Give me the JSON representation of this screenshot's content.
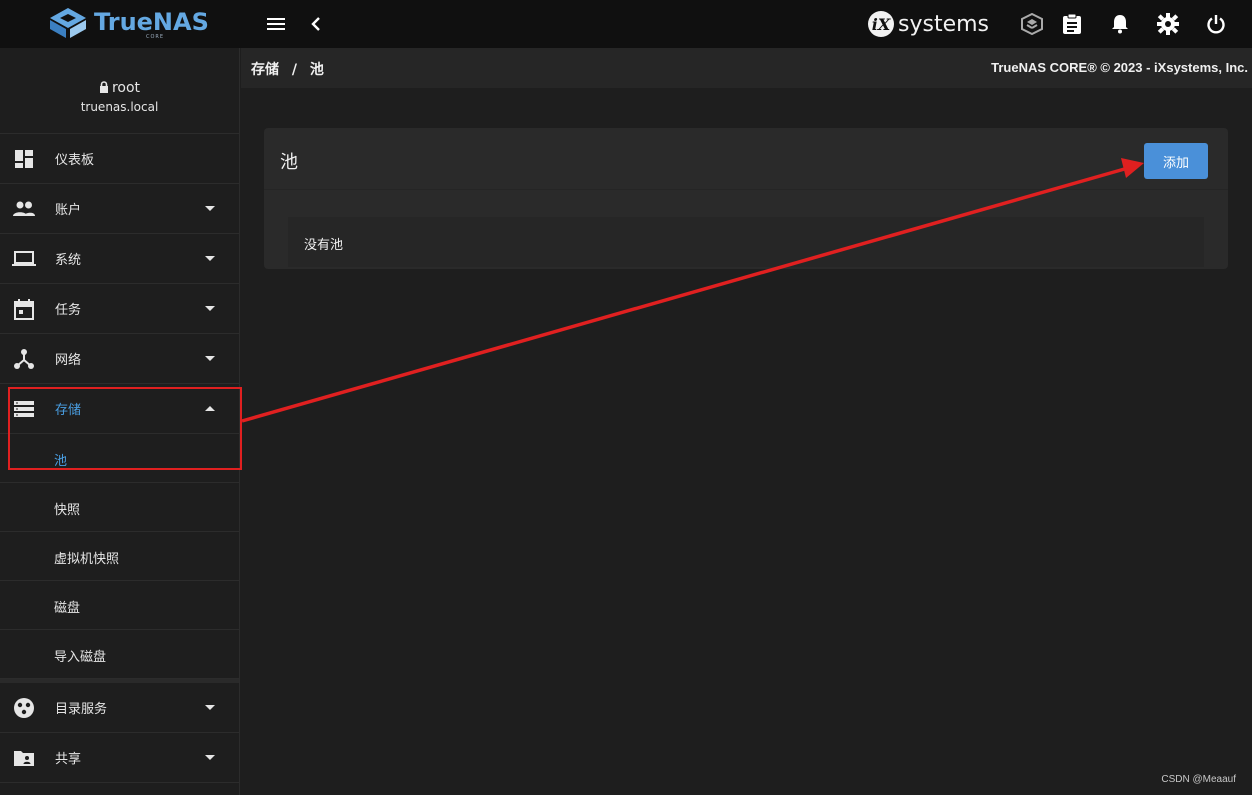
{
  "app": {
    "logo_text": "TrueNAS",
    "logo_sub": "CORE",
    "vendor_text": "systems",
    "vendor_mark": "iX"
  },
  "user": {
    "name": "root",
    "host": "truenas.local"
  },
  "sidebar": {
    "items": [
      {
        "label": "仪表板",
        "icon": "dashboard-icon"
      },
      {
        "label": "账户",
        "icon": "people-icon"
      },
      {
        "label": "系统",
        "icon": "laptop-icon"
      },
      {
        "label": "任务",
        "icon": "calendar-icon"
      },
      {
        "label": "网络",
        "icon": "network-icon"
      },
      {
        "label": "存储",
        "icon": "storage-icon"
      }
    ],
    "storage_sub": [
      {
        "label": "池"
      },
      {
        "label": "快照"
      },
      {
        "label": "虚拟机快照"
      },
      {
        "label": "磁盘"
      },
      {
        "label": "导入磁盘"
      }
    ],
    "items_after": [
      {
        "label": "目录服务",
        "icon": "directory-icon"
      },
      {
        "label": "共享",
        "icon": "share-folder-icon"
      }
    ]
  },
  "breadcrumb": {
    "parent": "存储",
    "separator": "/",
    "current": "池"
  },
  "copyright": "TrueNAS CORE® © 2023 - iXsystems, Inc.",
  "main": {
    "card_title": "池",
    "add_button": "添加",
    "empty_text": "没有池"
  },
  "watermark": "CSDN @Meaauf",
  "colors": {
    "accent": "#4a9fe3",
    "annotation": "#e02020",
    "button": "#4a90d9"
  }
}
